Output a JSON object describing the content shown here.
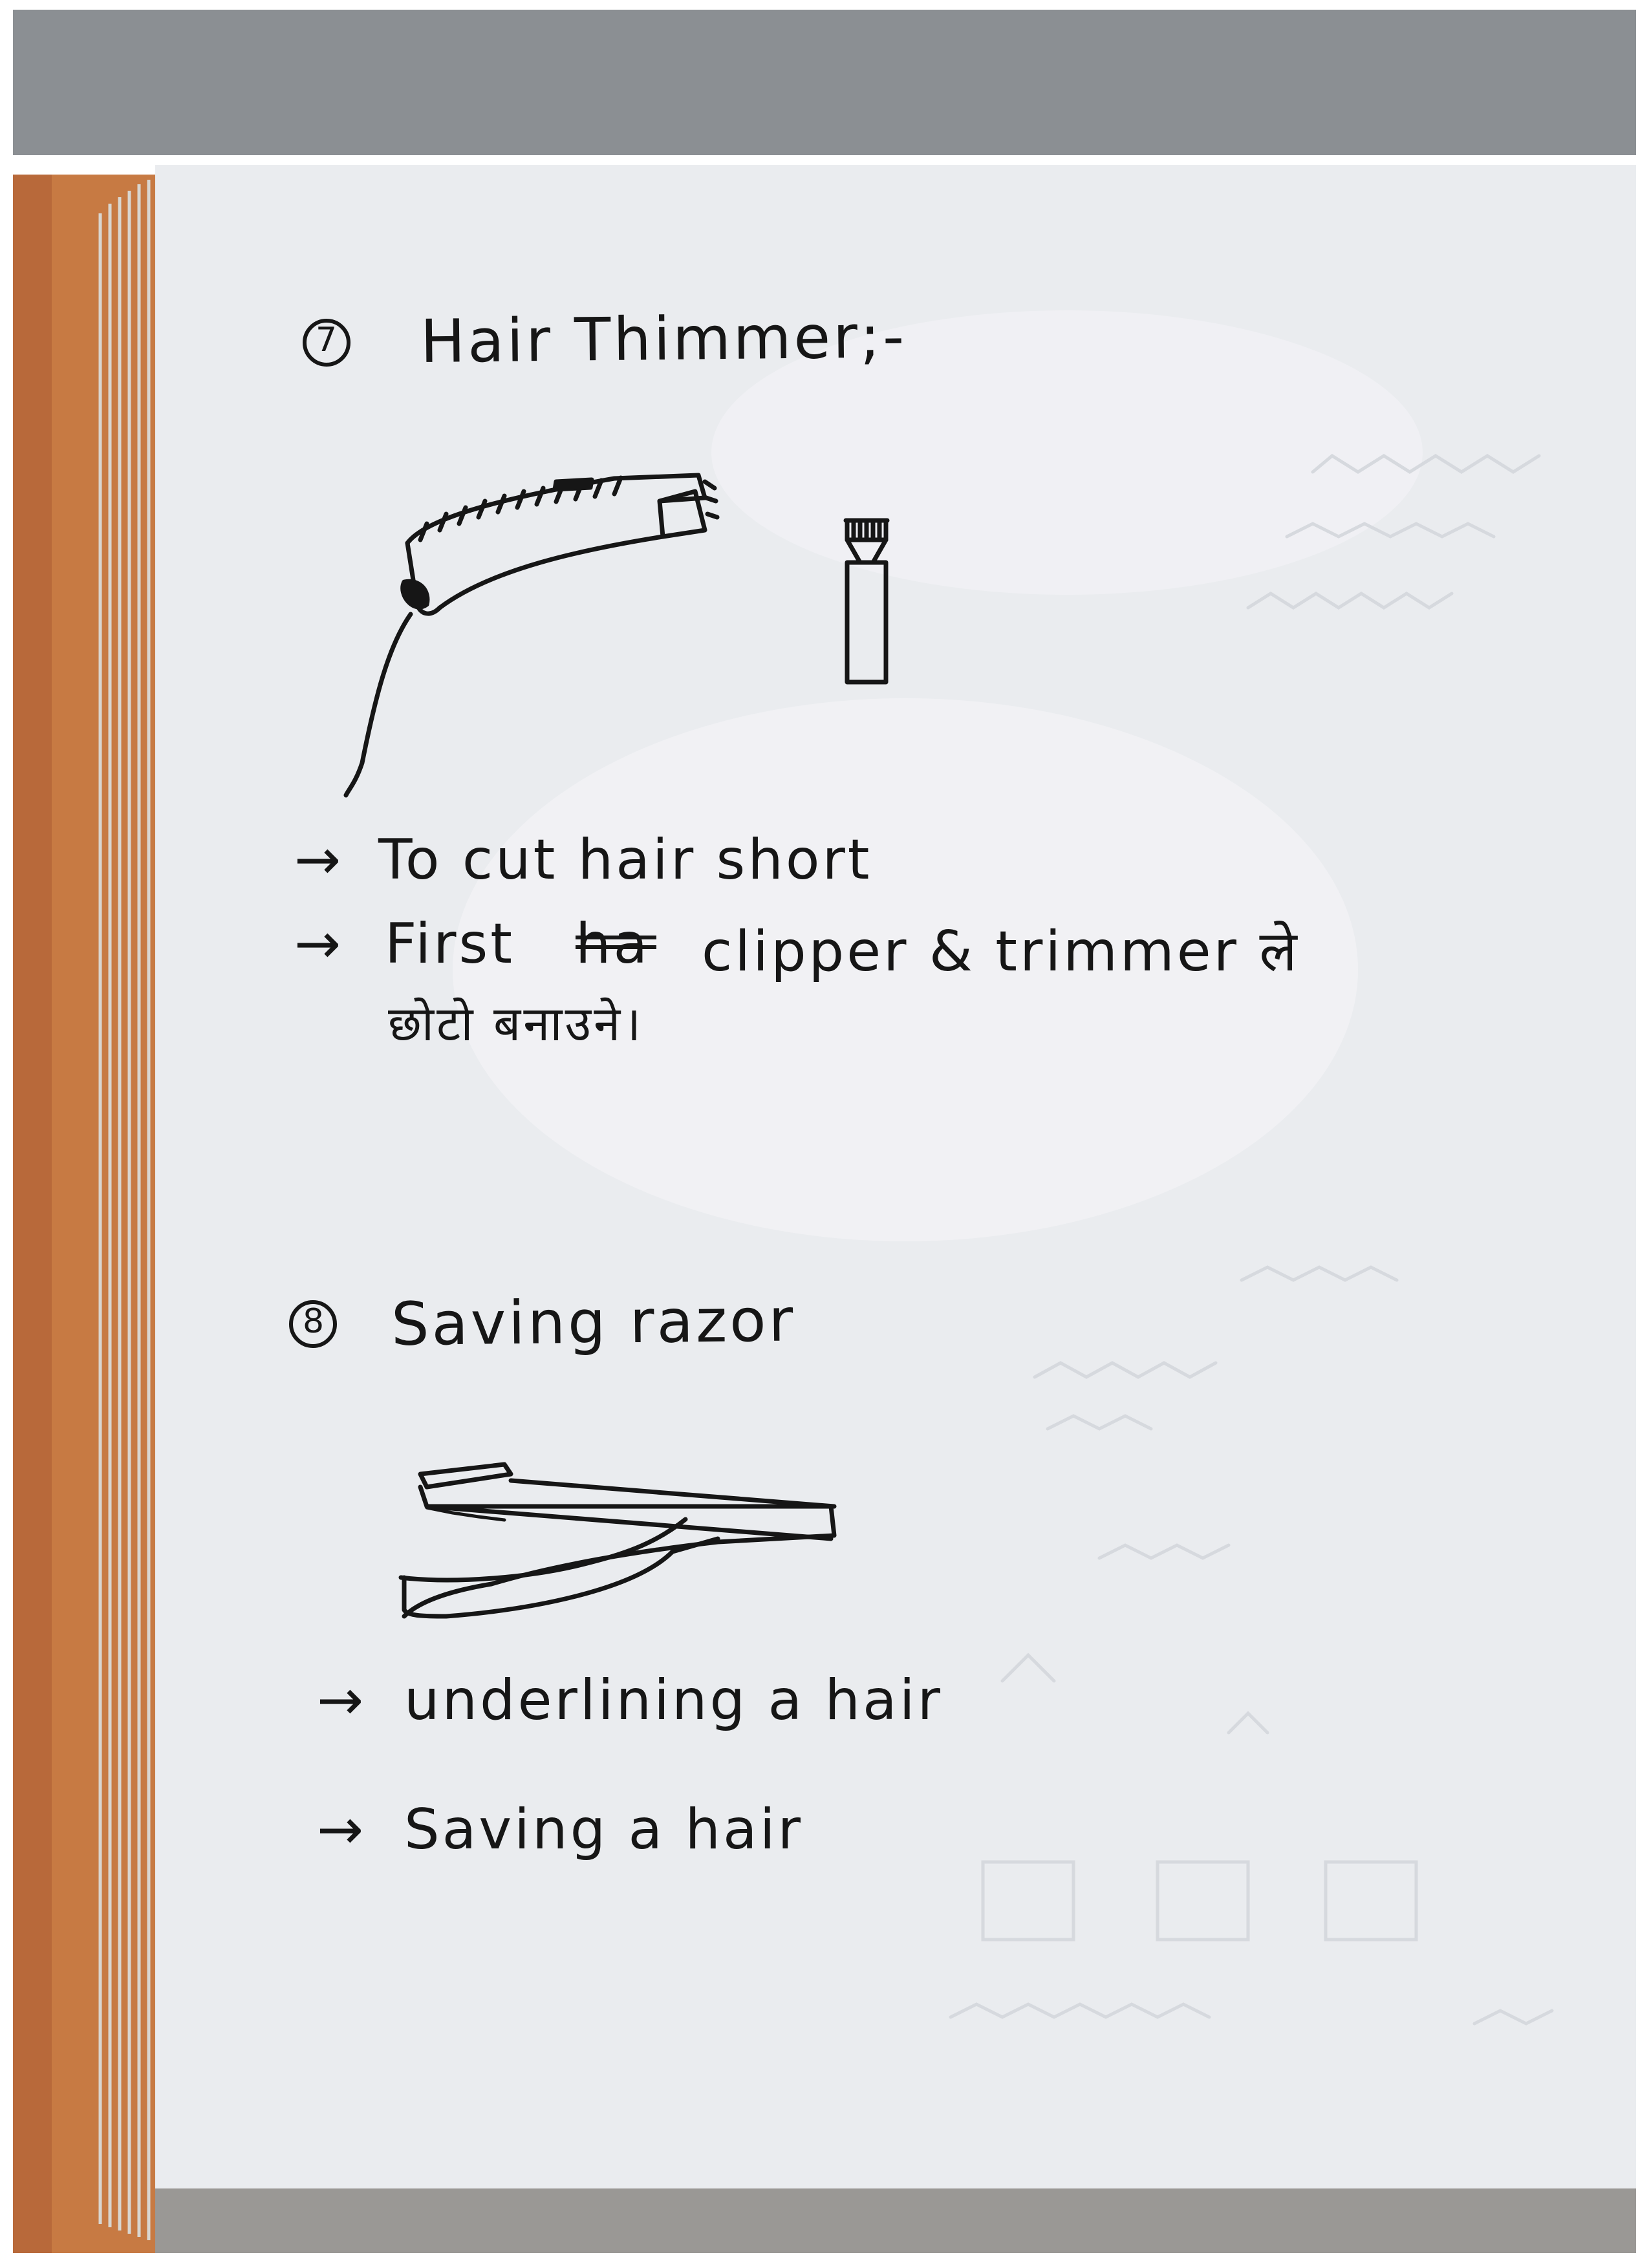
{
  "page": {
    "sections": [
      {
        "number": "7",
        "title": "Hair Thimmer;-",
        "sketch": "hair-trimmer-sketch",
        "notes": [
          {
            "arrow": "→",
            "text": "To cut hair short"
          },
          {
            "arrow": "→",
            "text": "First",
            "struck": "ha",
            "text_after": "clipper & trimmer ले",
            "continuation": "छोटो बनाउने।"
          }
        ]
      },
      {
        "number": "8",
        "title": "Saving razor",
        "sketch": "razor-sketch",
        "notes": [
          {
            "arrow": "→",
            "text": "underlining a hair"
          },
          {
            "arrow": "→",
            "text": "Saving a hair"
          }
        ]
      }
    ]
  }
}
